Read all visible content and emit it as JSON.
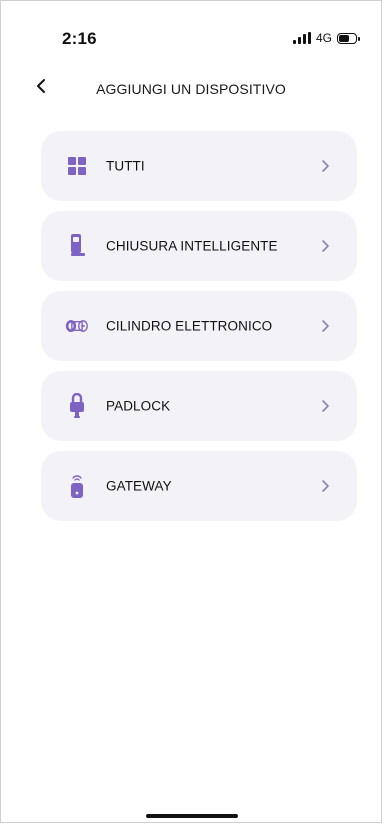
{
  "status_bar": {
    "time": "2:16",
    "network": "4G",
    "signal_icon": "signal-strength-icon",
    "battery_icon": "battery-icon"
  },
  "header": {
    "title": "AGGIUNGI UN DISPOSITIVO",
    "back_icon": "back-chevron-icon"
  },
  "device_list": {
    "items": [
      {
        "label": "TUTTI",
        "icon": "grid-icon"
      },
      {
        "label": "CHIUSURA INTELLIGENTE",
        "icon": "smart-lock-icon"
      },
      {
        "label": "CILINDRO ELETTRONICO",
        "icon": "electronic-cylinder-icon"
      },
      {
        "label": "PADLOCK",
        "icon": "padlock-icon"
      },
      {
        "label": "GATEWAY",
        "icon": "gateway-icon"
      }
    ],
    "chevron_icon": "chevron-right-icon"
  },
  "colors": {
    "accent": "#7f63c4",
    "card_background": "#f3f2f7",
    "text": "#111111",
    "chevron": "#8a82b8"
  }
}
